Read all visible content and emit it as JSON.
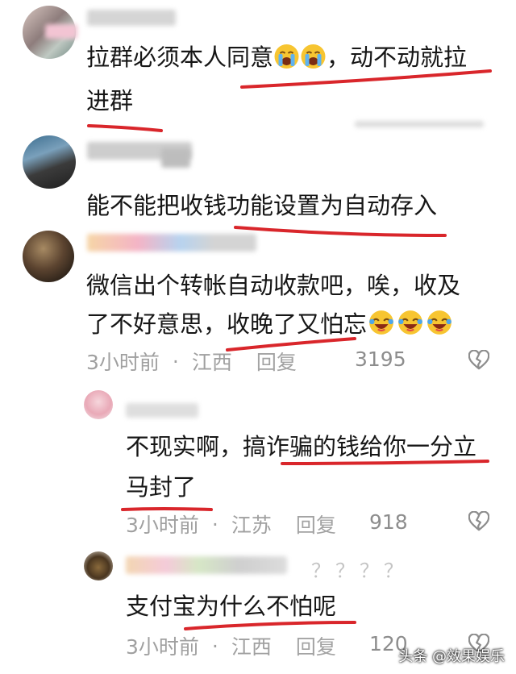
{
  "comments": [
    {
      "text_line1": "拉群必须本人同意",
      "text_line1_after": "，动不动就拉",
      "text_line2": "进群",
      "emoji": "loudly-crying-face"
    },
    {
      "text_line1": "能不能把收钱功能设置为自动存入"
    },
    {
      "text_line1": "微信出个转帐自动收款吧，唉，收及",
      "text_line2": "了不好意思，收晚了又怕忘",
      "emoji": "rolling-on-floor-laughing",
      "time": "3小时前",
      "location": "江西",
      "reply": "回复",
      "likes": "3195"
    },
    {
      "text_line1": "不现实啊，搞诈骗的钱给你一分立",
      "text_line2": "马封了",
      "time": "3小时前",
      "location": "江苏",
      "reply": "回复",
      "likes": "918"
    },
    {
      "text_line1": "支付宝为什么不怕呢",
      "time": "3小时前",
      "location": "江西",
      "reply": "回复",
      "likes": "120",
      "name_suffix": "？？？？"
    }
  ],
  "separator": "·",
  "watermark": "头条 @效果娱乐",
  "colors": {
    "underline": "#d9262b",
    "meta": "#a0a0a0",
    "text": "#161616"
  }
}
